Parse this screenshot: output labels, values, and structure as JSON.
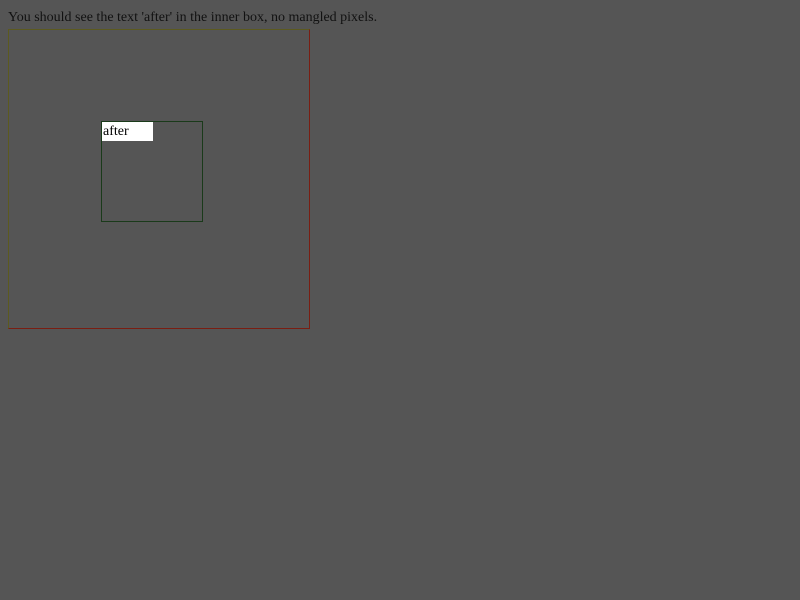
{
  "instruction": "You should see the text 'after' in the inner box, no mangled pixels.",
  "inner_box": {
    "text": "after"
  },
  "colors": {
    "background": "#555555",
    "outer_border_top_left": "#5c5a1f",
    "outer_border_bottom_right": "#7a1e12",
    "inner_border": "#1a3a1a",
    "text_bg": "#ffffff"
  }
}
